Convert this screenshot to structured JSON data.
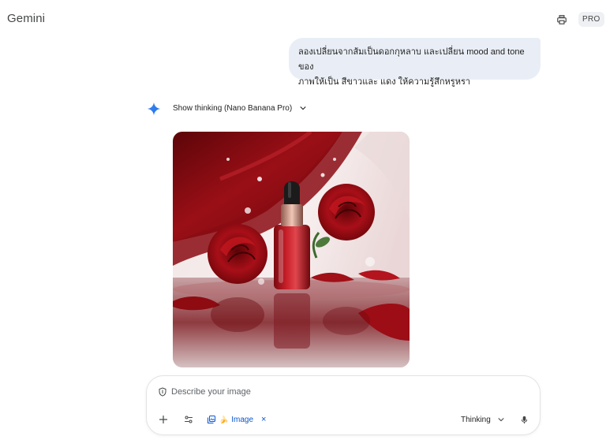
{
  "header": {
    "app_title": "Gemini",
    "pro_badge": "PRO"
  },
  "user_message": {
    "text_line1": "ลองเปลี่ยนจากส้มเป็นดอกกุหลาบ และเปลี่ยน mood and tone ของ",
    "text_line2": "ภาพให้เป็น สีขาวและ แดง ให้ความรู้สึกหรูหรา"
  },
  "response": {
    "thinking_label": "Show thinking (Nano Banana Pro)"
  },
  "composer": {
    "placeholder": "Describe your image",
    "image_chip_label": "Image",
    "chip_emoji": "🍌",
    "chip_close": "×",
    "mode_label": "Thinking"
  },
  "colors": {
    "user_bubble": "#e9eef6",
    "accent_blue": "#0b57d0",
    "spark_start": "#4285f4",
    "spark_end": "#1a73e8"
  },
  "icons": {
    "print": "print-icon",
    "spark": "gemini-spark-icon",
    "chevron": "chevron-down-icon",
    "shield": "shield-icon",
    "add": "add-icon",
    "tools": "tools-icon",
    "image_gen": "image-gen-icon",
    "mic": "microphone-icon"
  }
}
